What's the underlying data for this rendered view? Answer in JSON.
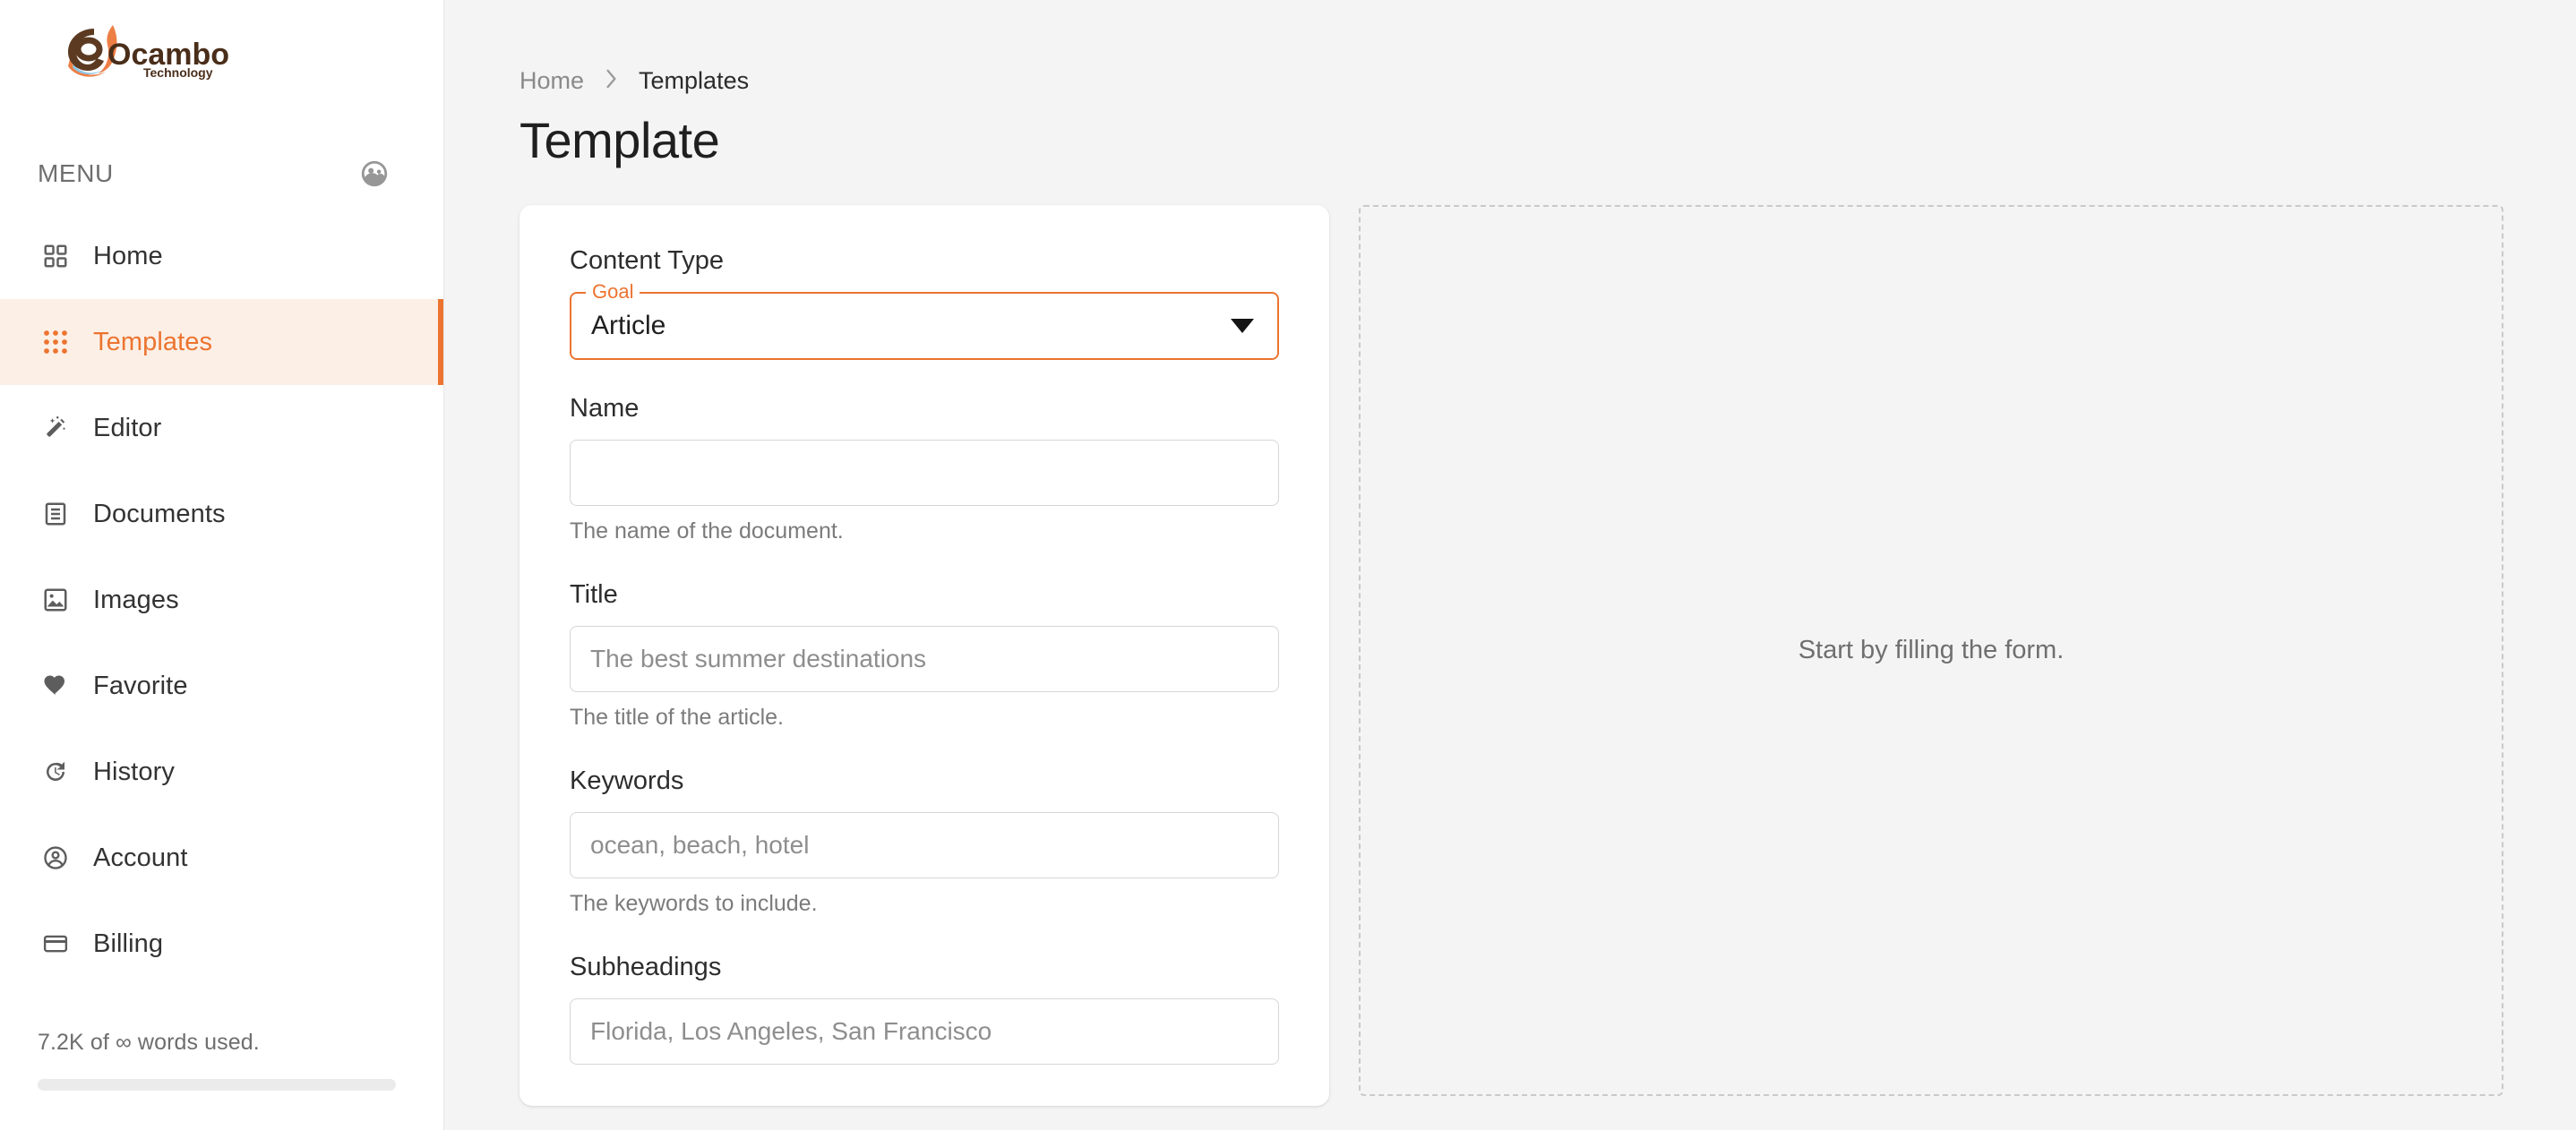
{
  "brand": {
    "name": "eOcambo",
    "tagline": "Technology",
    "logo_colors": {
      "brown": "#5C3A21",
      "orange": "#ED7F45",
      "blue": "#8FC6E8"
    }
  },
  "theme": {
    "accent": "#ec7430",
    "accent_soft": "#fcefe6",
    "page_bg": "#f4f4f4",
    "sidebar_bg": "#ffffff",
    "text": "#333333",
    "muted": "#7b7b7b"
  },
  "sidebar": {
    "menu_label": "MENU",
    "menu_header_icon": "supervised-user-circle-icon",
    "items": [
      {
        "label": "Home",
        "icon": "grid-apps-icon",
        "active": false
      },
      {
        "label": "Templates",
        "icon": "dots-grid-icon",
        "active": true
      },
      {
        "label": "Editor",
        "icon": "magic-wand-icon",
        "active": false
      },
      {
        "label": "Documents",
        "icon": "document-icon",
        "active": false
      },
      {
        "label": "Images",
        "icon": "image-icon",
        "active": false
      },
      {
        "label": "Favorite",
        "icon": "heart-icon",
        "active": false
      },
      {
        "label": "History",
        "icon": "history-icon",
        "active": false
      },
      {
        "label": "Account",
        "icon": "account-circle-icon",
        "active": false
      },
      {
        "label": "Billing",
        "icon": "credit-card-icon",
        "active": false
      }
    ],
    "usage": {
      "text": "7.2K of ∞ words used.",
      "used": "7.2K",
      "limit": "∞",
      "progress_percent": 0
    }
  },
  "breadcrumb": {
    "items": [
      {
        "label": "Home",
        "current": false
      },
      {
        "label": "Templates",
        "current": true
      }
    ],
    "separator": "›"
  },
  "page": {
    "title": "Template"
  },
  "form": {
    "content_type": {
      "label": "Content Type",
      "legend": "Goal",
      "value": "Article",
      "options": [
        "Article"
      ],
      "arrow_icon": "chevron-down-icon"
    },
    "fields": [
      {
        "label": "Name",
        "value": "",
        "placeholder": "",
        "help": "The name of the document."
      },
      {
        "label": "Title",
        "value": "",
        "placeholder": "The best summer destinations",
        "help": "The title of the article."
      },
      {
        "label": "Keywords",
        "value": "",
        "placeholder": "ocean, beach, hotel",
        "help": "The keywords to include."
      },
      {
        "label": "Subheadings",
        "value": "",
        "placeholder": "Florida, Los Angeles, San Francisco",
        "help": ""
      }
    ]
  },
  "preview": {
    "empty_text": "Start by filling the form."
  }
}
